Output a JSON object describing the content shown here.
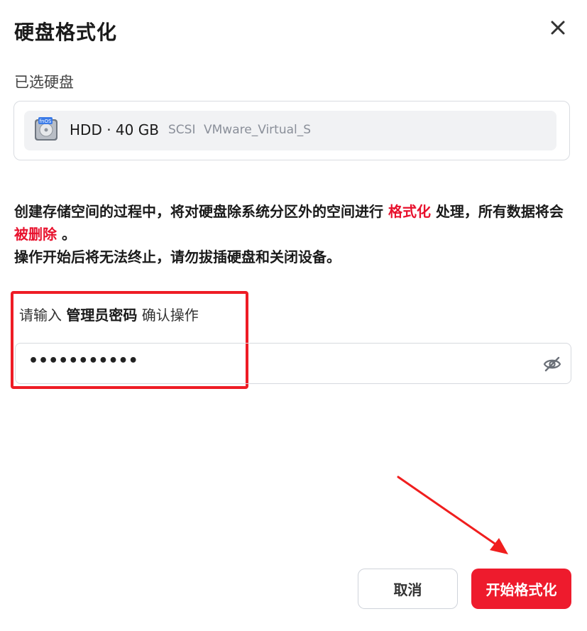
{
  "dialog": {
    "title": "硬盘格式化"
  },
  "selected_disk": {
    "section_label": "已选硬盘",
    "icon_text": "fnOS",
    "name": "HDD · 40 GB",
    "bus": "SCSI",
    "model": "VMware_Virtual_S"
  },
  "warning": {
    "part1": "创建存储空间的过程中，将对硬盘除系统分区外的空间进行",
    "highlight1": "格式化",
    "part2": "处理，所有数据将会",
    "highlight2": "被删除",
    "part3": "。",
    "line2": "操作开始后将无法终止，请勿拔插硬盘和关闭设备。"
  },
  "password": {
    "label_prefix": "请输入",
    "label_bold": "管理员密码",
    "label_suffix": "确认操作",
    "value": "•••••••••••"
  },
  "buttons": {
    "cancel": "取消",
    "confirm": "开始格式化"
  },
  "colors": {
    "accent_red": "#ee1b2d",
    "highlight_red": "#e8112d"
  }
}
